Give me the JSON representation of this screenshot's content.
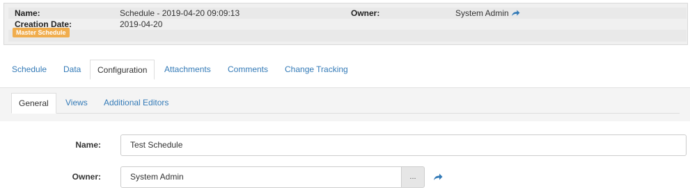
{
  "header": {
    "name_label": "Name:",
    "name_value": "Schedule - 2019-04-20 09:09:13",
    "owner_label": "Owner:",
    "owner_value": "System Admin",
    "creation_label": "Creation Date:",
    "creation_value": "2019-04-20",
    "badge": "Master Schedule"
  },
  "tabs": [
    {
      "label": "Schedule"
    },
    {
      "label": "Data"
    },
    {
      "label": "Configuration",
      "active": true
    },
    {
      "label": "Attachments"
    },
    {
      "label": "Comments"
    },
    {
      "label": "Change Tracking"
    }
  ],
  "subtabs": [
    {
      "label": "General",
      "active": true
    },
    {
      "label": "Views"
    },
    {
      "label": "Additional Editors"
    }
  ],
  "form": {
    "name_label": "Name:",
    "name_value": "Test Schedule",
    "owner_label": "Owner:",
    "owner_value": "System Admin",
    "picker_label": "..."
  },
  "colors": {
    "link": "#337ab7",
    "badge": "#f0ad4e",
    "panel": "#f0f0f0"
  }
}
